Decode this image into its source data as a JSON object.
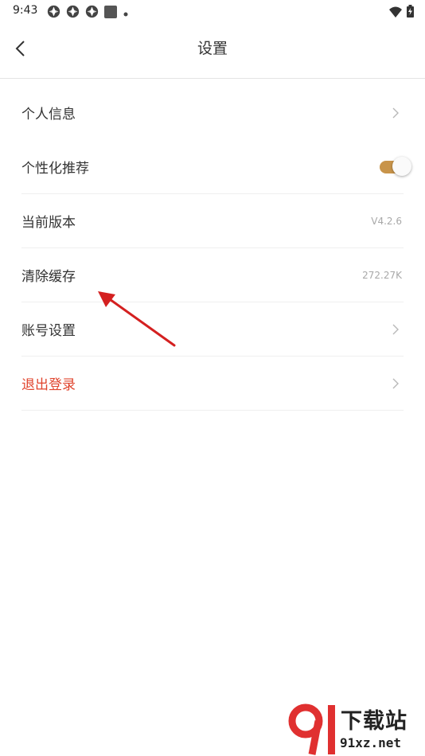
{
  "status_bar": {
    "time": "9:43"
  },
  "header": {
    "title": "设置"
  },
  "settings": {
    "personal_info": "个人信息",
    "personalized_recommend": "个性化推荐",
    "current_version": "当前版本",
    "version_value": "V4.2.6",
    "clear_cache": "清除缓存",
    "cache_value": "272.27K",
    "account_settings": "账号设置",
    "logout": "退出登录"
  },
  "toggle": {
    "personalized_recommend_on": true
  },
  "colors": {
    "toggle_on": "#c8944a",
    "danger": "#e0442d",
    "arrow": "#d42020"
  },
  "watermark": {
    "brand": "下载站",
    "domain": "91xz.net"
  }
}
